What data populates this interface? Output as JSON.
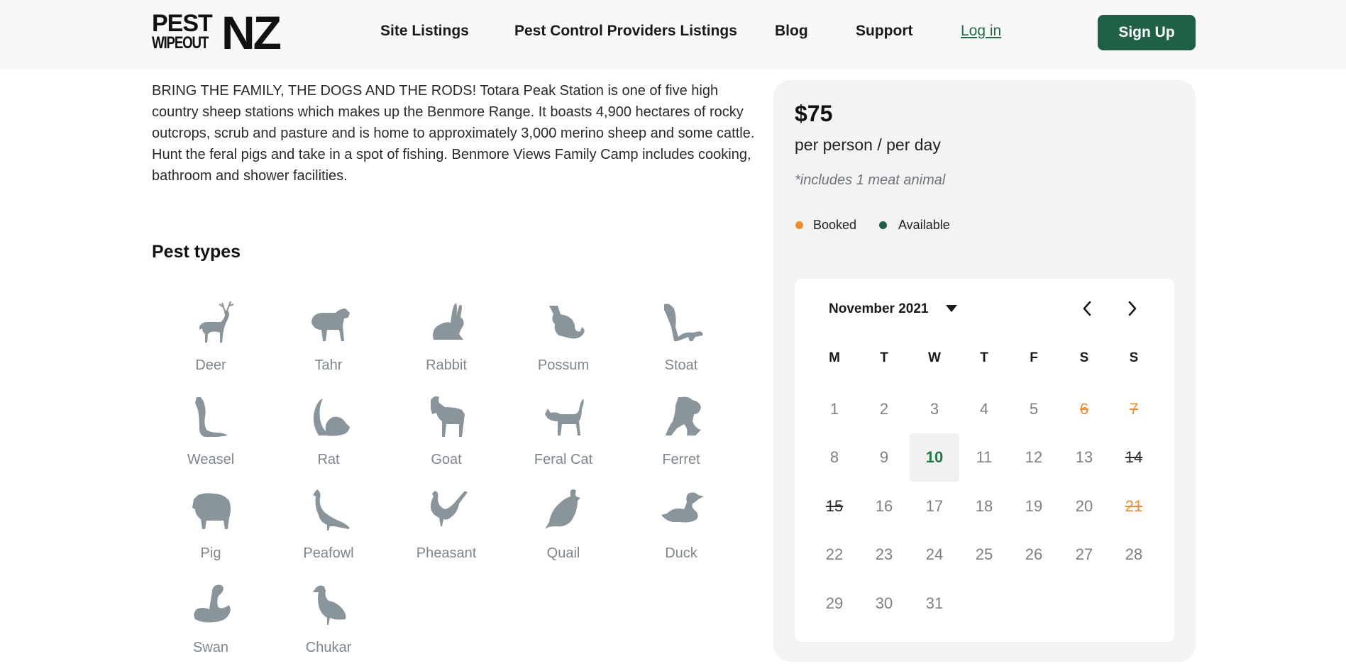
{
  "header": {
    "logo": {
      "top": "PEST",
      "bottom": "WIPEOUT",
      "right": "NZ"
    },
    "nav": [
      {
        "label": "Site Listings"
      },
      {
        "label": "Pest Control Providers Listings"
      },
      {
        "label": "Blog"
      },
      {
        "label": "Support"
      },
      {
        "label": "Log in"
      }
    ],
    "signup_label": "Sign Up"
  },
  "description": "BRING THE FAMILY, THE DOGS AND THE RODS! Totara Peak Station is one of five high country sheep stations which makes up the Benmore Range. It boasts 4,900 hectares of rocky outcrops, scrub and pasture and is home to approximately 3,000 merino sheep and some cattle. Hunt the feral pigs and take in a spot of fishing. Benmore Views Family Camp includes cooking, bathroom and shower facilities.",
  "pest_types": {
    "title": "Pest types",
    "items": [
      {
        "label": "Deer",
        "icon": "deer-icon"
      },
      {
        "label": "Tahr",
        "icon": "tahr-icon"
      },
      {
        "label": "Rabbit",
        "icon": "rabbit-icon"
      },
      {
        "label": "Possum",
        "icon": "possum-icon"
      },
      {
        "label": "Stoat",
        "icon": "stoat-icon"
      },
      {
        "label": "Weasel",
        "icon": "weasel-icon"
      },
      {
        "label": "Rat",
        "icon": "rat-icon"
      },
      {
        "label": "Goat",
        "icon": "goat-icon"
      },
      {
        "label": "Feral Cat",
        "icon": "feral-cat-icon"
      },
      {
        "label": "Ferret",
        "icon": "ferret-icon"
      },
      {
        "label": "Pig",
        "icon": "pig-icon"
      },
      {
        "label": "Peafowl",
        "icon": "peafowl-icon"
      },
      {
        "label": "Pheasant",
        "icon": "pheasant-icon"
      },
      {
        "label": "Quail",
        "icon": "quail-icon"
      },
      {
        "label": "Duck",
        "icon": "duck-icon"
      },
      {
        "label": "Swan",
        "icon": "swan-icon"
      },
      {
        "label": "Chukar",
        "icon": "chukar-icon"
      }
    ]
  },
  "pricing": {
    "price": "$75",
    "unit": "per person / per day",
    "note": "*includes 1 meat animal"
  },
  "legend": {
    "booked_label": "Booked",
    "booked_color": "#f28c28",
    "available_label": "Available",
    "available_color": "#1f6146"
  },
  "calendar": {
    "month_label": "November 2021",
    "weekdays": [
      "M",
      "T",
      "W",
      "T",
      "F",
      "S",
      "S"
    ],
    "days": [
      {
        "d": "1",
        "state": "normal"
      },
      {
        "d": "2",
        "state": "normal"
      },
      {
        "d": "3",
        "state": "normal"
      },
      {
        "d": "4",
        "state": "normal"
      },
      {
        "d": "5",
        "state": "normal"
      },
      {
        "d": "6",
        "state": "booked"
      },
      {
        "d": "7",
        "state": "booked"
      },
      {
        "d": "8",
        "state": "normal"
      },
      {
        "d": "9",
        "state": "normal"
      },
      {
        "d": "10",
        "state": "today"
      },
      {
        "d": "11",
        "state": "normal"
      },
      {
        "d": "12",
        "state": "normal"
      },
      {
        "d": "13",
        "state": "normal"
      },
      {
        "d": "14",
        "state": "struck"
      },
      {
        "d": "15",
        "state": "struck"
      },
      {
        "d": "16",
        "state": "normal"
      },
      {
        "d": "17",
        "state": "normal"
      },
      {
        "d": "18",
        "state": "normal"
      },
      {
        "d": "19",
        "state": "normal"
      },
      {
        "d": "20",
        "state": "normal"
      },
      {
        "d": "21",
        "state": "booked"
      },
      {
        "d": "22",
        "state": "normal"
      },
      {
        "d": "23",
        "state": "normal"
      },
      {
        "d": "24",
        "state": "normal"
      },
      {
        "d": "25",
        "state": "normal"
      },
      {
        "d": "26",
        "state": "normal"
      },
      {
        "d": "27",
        "state": "normal"
      },
      {
        "d": "28",
        "state": "normal"
      },
      {
        "d": "29",
        "state": "normal"
      },
      {
        "d": "30",
        "state": "normal"
      },
      {
        "d": "31",
        "state": "normal"
      }
    ]
  }
}
